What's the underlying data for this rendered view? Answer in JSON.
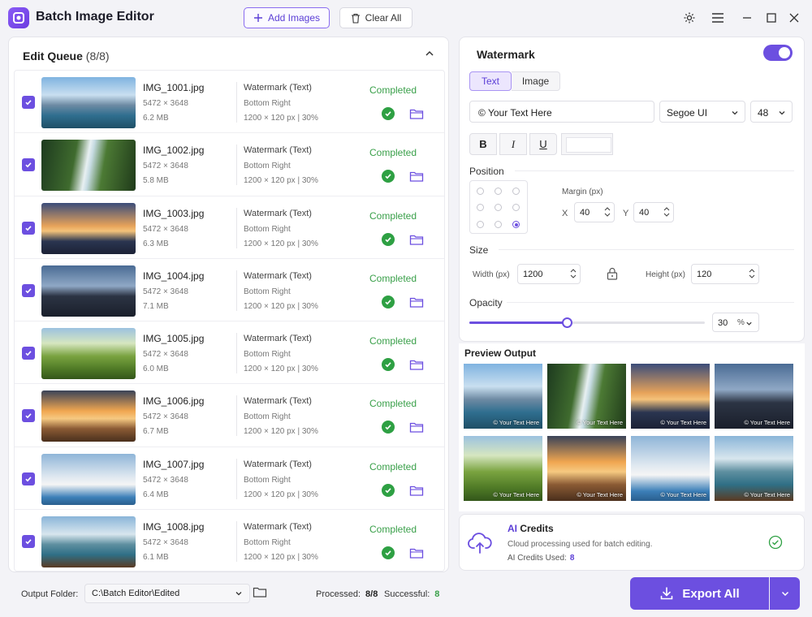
{
  "app": {
    "title": "Batch Image Editor"
  },
  "toolbar": {
    "add_images": "Add Images",
    "clear_all": "Clear All"
  },
  "queue": {
    "title": "Edit Queue",
    "count": "(8/8)",
    "items": [
      {
        "name": "IMG_1001.jpg",
        "dims": "5472 × 3648",
        "size": "6.2 MB",
        "wm_type": "Watermark (Text)",
        "wm_pos": "Bottom Right",
        "wm_size": "1200 × 120 px  |  30%",
        "status": "Completed"
      },
      {
        "name": "IMG_1002.jpg",
        "dims": "5472 × 3648",
        "size": "5.8 MB",
        "wm_type": "Watermark (Text)",
        "wm_pos": "Bottom Right",
        "wm_size": "1200 × 120 px  |  30%",
        "status": "Completed"
      },
      {
        "name": "IMG_1003.jpg",
        "dims": "5472 × 3648",
        "size": "6.3 MB",
        "wm_type": "Watermark (Text)",
        "wm_pos": "Bottom Right",
        "wm_size": "1200 × 120 px  |  30%",
        "status": "Completed"
      },
      {
        "name": "IMG_1004.jpg",
        "dims": "5472 × 3648",
        "size": "7.1 MB",
        "wm_type": "Watermark (Text)",
        "wm_pos": "Bottom Right",
        "wm_size": "1200 × 120 px  |  30%",
        "status": "Completed"
      },
      {
        "name": "IMG_1005.jpg",
        "dims": "5472 × 3648",
        "size": "6.0 MB",
        "wm_type": "Watermark (Text)",
        "wm_pos": "Bottom Right",
        "wm_size": "1200 × 120 px  |  30%",
        "status": "Completed"
      },
      {
        "name": "IMG_1006.jpg",
        "dims": "5472 × 3648",
        "size": "6.7 MB",
        "wm_type": "Watermark (Text)",
        "wm_pos": "Bottom Right",
        "wm_size": "1200 × 120 px  |  30%",
        "status": "Completed"
      },
      {
        "name": "IMG_1007.jpg",
        "dims": "5472 × 3648",
        "size": "6.4 MB",
        "wm_type": "Watermark (Text)",
        "wm_pos": "Bottom Right",
        "wm_size": "1200 × 120 px  |  30%",
        "status": "Completed"
      },
      {
        "name": "IMG_1008.jpg",
        "dims": "5472 × 3648",
        "size": "6.1 MB",
        "wm_type": "Watermark (Text)",
        "wm_pos": "Bottom Right",
        "wm_size": "1200 × 120 px  |  30%",
        "status": "Completed"
      }
    ]
  },
  "footer": {
    "output_label": "Output Folder:",
    "output_path": "C:\\Batch Editor\\Edited",
    "processed_label": "Processed:",
    "processed_value": "8/8",
    "successful_label": "Successful:",
    "successful_value": "8"
  },
  "watermark": {
    "title": "Watermark",
    "enabled": true,
    "tab_text": "Text",
    "tab_image": "Image",
    "text_value": "© Your Text Here",
    "font": "Segoe UI",
    "font_size": "48",
    "bold": "B",
    "italic": "I",
    "underline": "U",
    "text_color": "#ffffff",
    "position_label": "Position",
    "position_selected": "bottom-right",
    "margin_label": "Margin (px)",
    "margin_x_label": "X",
    "margin_x": "40",
    "margin_y_label": "Y",
    "margin_y": "40",
    "size_label": "Size",
    "width_label": "Width (px)",
    "width": "1200",
    "height_label": "Height (px)",
    "height": "120",
    "opacity_label": "Opacity",
    "opacity": "30",
    "opacity_unit": "%",
    "opacity_fraction": 0.3
  },
  "preview": {
    "title": "Preview Output",
    "watermark_text": "© Your Text Here"
  },
  "credits": {
    "title_prefix": "AI",
    "title_suffix": "Credits",
    "description": "Cloud processing used for batch editing.",
    "used_label": "AI Credits Used:",
    "used_value": "8"
  },
  "export": {
    "label": "Export All"
  },
  "colors": {
    "accent": "#6c4fe0",
    "success": "#2ea043"
  }
}
